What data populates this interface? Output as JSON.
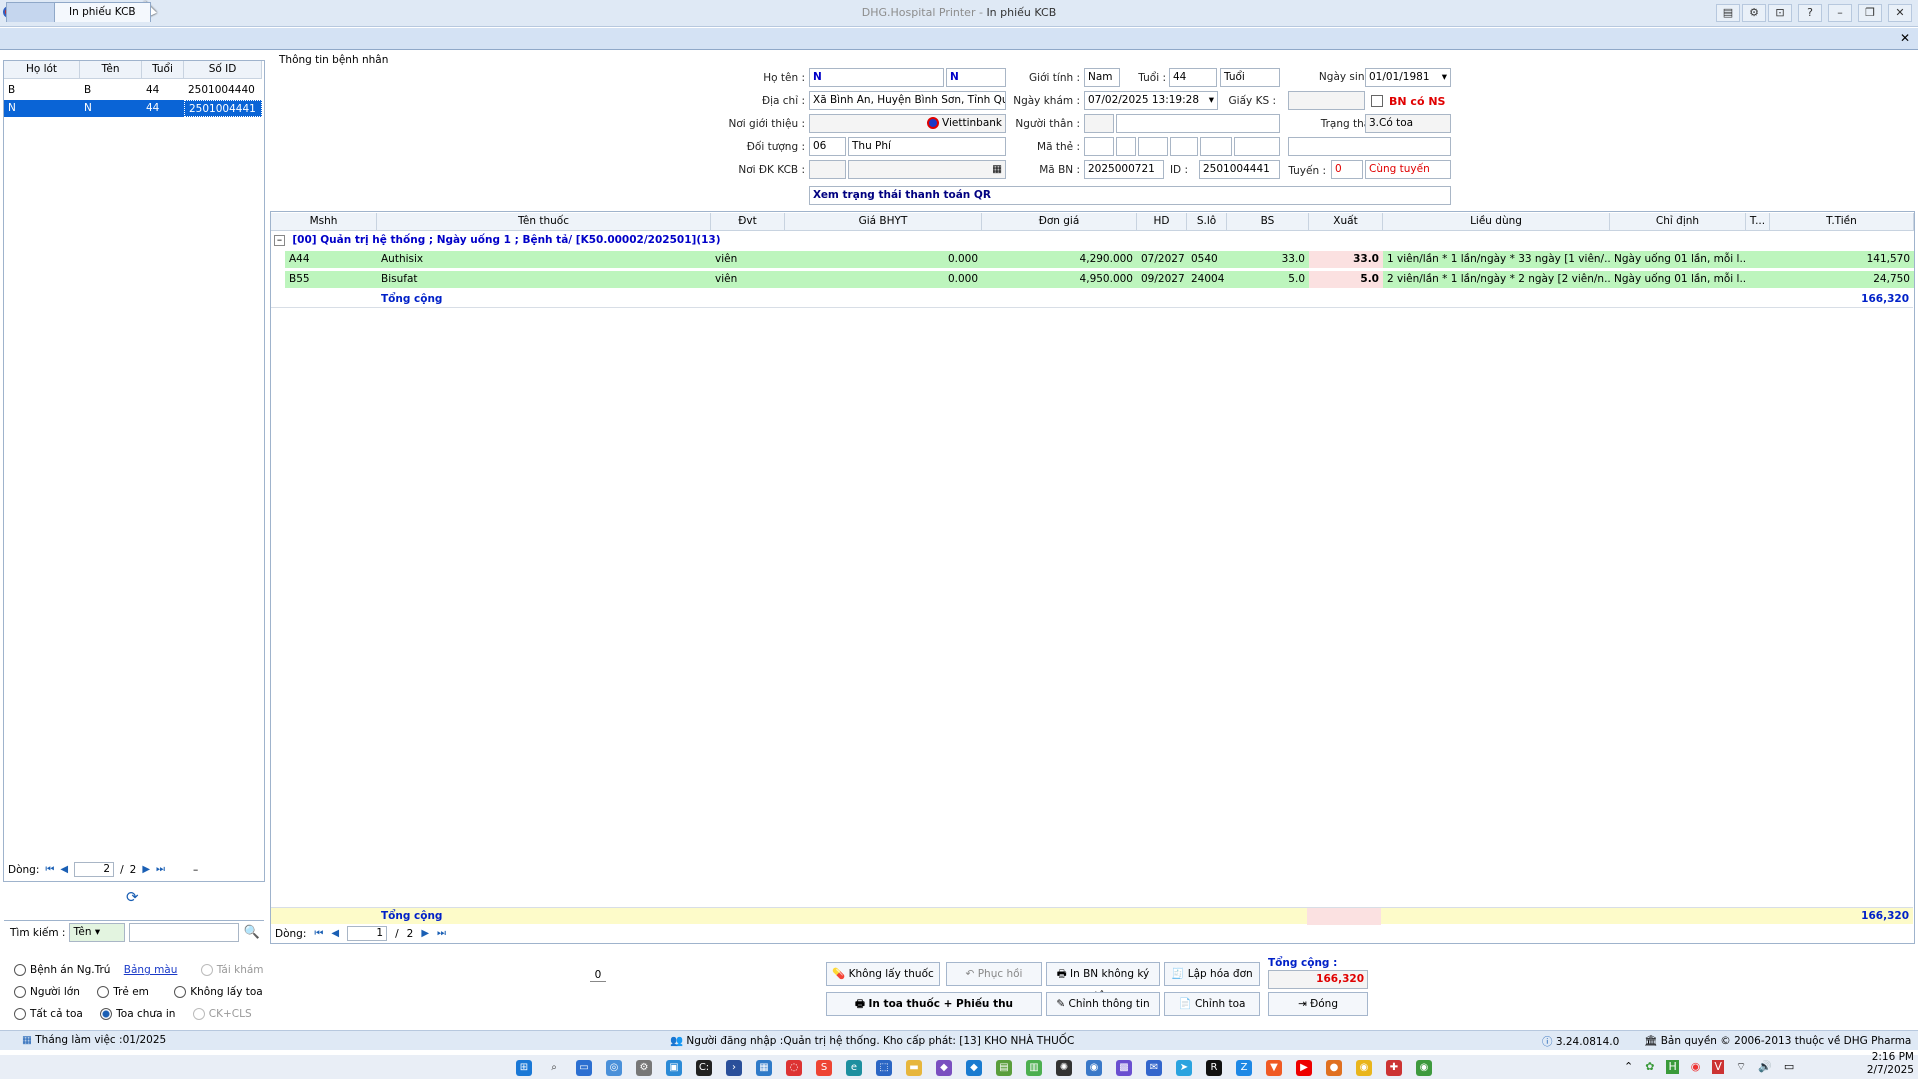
{
  "window": {
    "app": "DHG.Hospital Printer",
    "sep": " - ",
    "title": "In phiếu KCB"
  },
  "tab": "In phiếu KCB",
  "patients": {
    "headers": [
      "Họ lót",
      "Tên",
      "Tuổi",
      "Số ID"
    ],
    "rows": [
      [
        "B",
        "B",
        "44",
        "2501004440"
      ],
      [
        "N",
        "N",
        "44",
        "2501004441"
      ]
    ],
    "nav": {
      "label": "Dòng:",
      "page": "2",
      "total": "2",
      "sep": "/ "
    }
  },
  "search": {
    "label": "Tìm kiếm :",
    "field": "Tên"
  },
  "filters": {
    "benh_an": "Bệnh án Ng.Trú",
    "bang_mau": "Bảng màu",
    "tai_kham": "Tái khám",
    "nguoi_lon": "Người lớn",
    "tre_em": "Trẻ em",
    "khong_lay_toa": "Không lấy toa",
    "tat_ca_toa": "Tất cả toa",
    "toa_chua_in": "Toa chưa in",
    "ck_cls": "CK+CLS"
  },
  "info": {
    "section": "Thông tin bệnh nhân",
    "ho_ten_lbl": "Họ tên :",
    "ho_ten1": "N",
    "ho_ten2": "N",
    "gioi_tinh_lbl": "Giới tính :",
    "gioi_tinh": "Nam",
    "tuoi_lbl": "Tuổi :",
    "tuoi": "44",
    "tuoi_unit": "Tuổi",
    "ngay_sinh_lbl": "Ngày sinh :",
    "ngay_sinh": "01/01/1981",
    "dia_chi_lbl": "Địa chỉ :",
    "dia_chi": "Xã Bình An, Huyện Bình Sơn, Tỉnh Quảng",
    "ngay_kham_lbl": "Ngày khám :",
    "ngay_kham": "07/02/2025 13:19:28",
    "giay_ks_lbl": "Giấy KS :",
    "bn_co_ns": "BN có NS",
    "noi_gt_lbl": "Nơi giới thiệu :",
    "viettinbank": "Viettinbank",
    "nguoi_than_lbl": "Người thân :",
    "trang_thai_lbl": "Trạng thái :",
    "trang_thai": "3.Có toa",
    "doi_tuong_lbl": "Đối tượng :",
    "doi_tuong_code": "06",
    "doi_tuong": "Thu Phí",
    "ma_the_lbl": "Mã thẻ :",
    "noi_dk_lbl": "Nơi ĐK KCB :",
    "ma_bn_lbl": "Mã BN :",
    "ma_bn": "2025000721",
    "id_lbl": "ID :",
    "id": "2501004441",
    "tuyen_lbl": "Tuyến :",
    "tuyen_code": "0",
    "tuyen": "Cùng tuyến",
    "qr": "Xem trạng thái thanh toán QR"
  },
  "grid": {
    "headers": [
      "Mshh",
      "Tên thuốc",
      "Đvt",
      "Giá BHYT",
      "Đơn giá",
      "HD",
      "S.lô",
      "BS",
      "Xuất",
      "Liều dùng",
      "Chỉ định",
      "T...",
      "T.Tiền"
    ],
    "group": "[00] Quản trị hệ thống ; Ngày uống 1 ; Bệnh tả/ [K50.00002/202501](13)",
    "rows": [
      [
        "A44",
        "Authisix",
        "viên",
        "0.000",
        "4,290.000",
        "07/2027",
        "0540",
        "33.0",
        "33.0",
        "1 viên/lần * 1 lần/ngày * 33 ngày [1 viên/...",
        "Ngày uống 01 lần, mỗi l...",
        "",
        "141,570"
      ],
      [
        "B55",
        "Bisufat",
        "viên",
        "0.000",
        "4,950.000",
        "09/2027",
        "24004",
        "5.0",
        "5.0",
        "2 viên/lần * 1 lần/ngày * 2 ngày [2 viên/n...",
        "Ngày uống 01 lần, mỗi l...",
        "",
        "24,750"
      ]
    ],
    "total_label": "Tổng cộng",
    "total": "166,320",
    "footer_total_label": "Tổng cộng",
    "footer_total": "166,320",
    "nav": {
      "label": "Dòng:",
      "page": "1",
      "total": "2",
      "sep": "/ "
    }
  },
  "bottom": {
    "counter": "0",
    "khong_lay_thuoc": "Không lấy thuốc",
    "phuc_hoi": "Phục hồi",
    "in_bn": "In BN không ký tên",
    "lap_hoa_don": "Lập hóa đơn",
    "in_toa": "In toa thuốc + Phiếu thu",
    "chinh_thong_tin": "Chỉnh thông tin",
    "chinh_toa": "Chỉnh toa",
    "dong": "Đóng",
    "tong_cong_lbl": "Tổng cộng :",
    "tong_cong": "166,320"
  },
  "status": {
    "thang": "Tháng làm việc :01/2025",
    "login": "Người đăng nhập :Quản trị hệ thống. Kho cấp phát: [13] KHO NHÀ THUỐC",
    "version": "3.24.0814.0",
    "copyright": "Bản quyền © 2006-2013 thuộc về DHG Pharma"
  },
  "clock": {
    "time": "2:16 PM",
    "date": "2/7/2025"
  }
}
